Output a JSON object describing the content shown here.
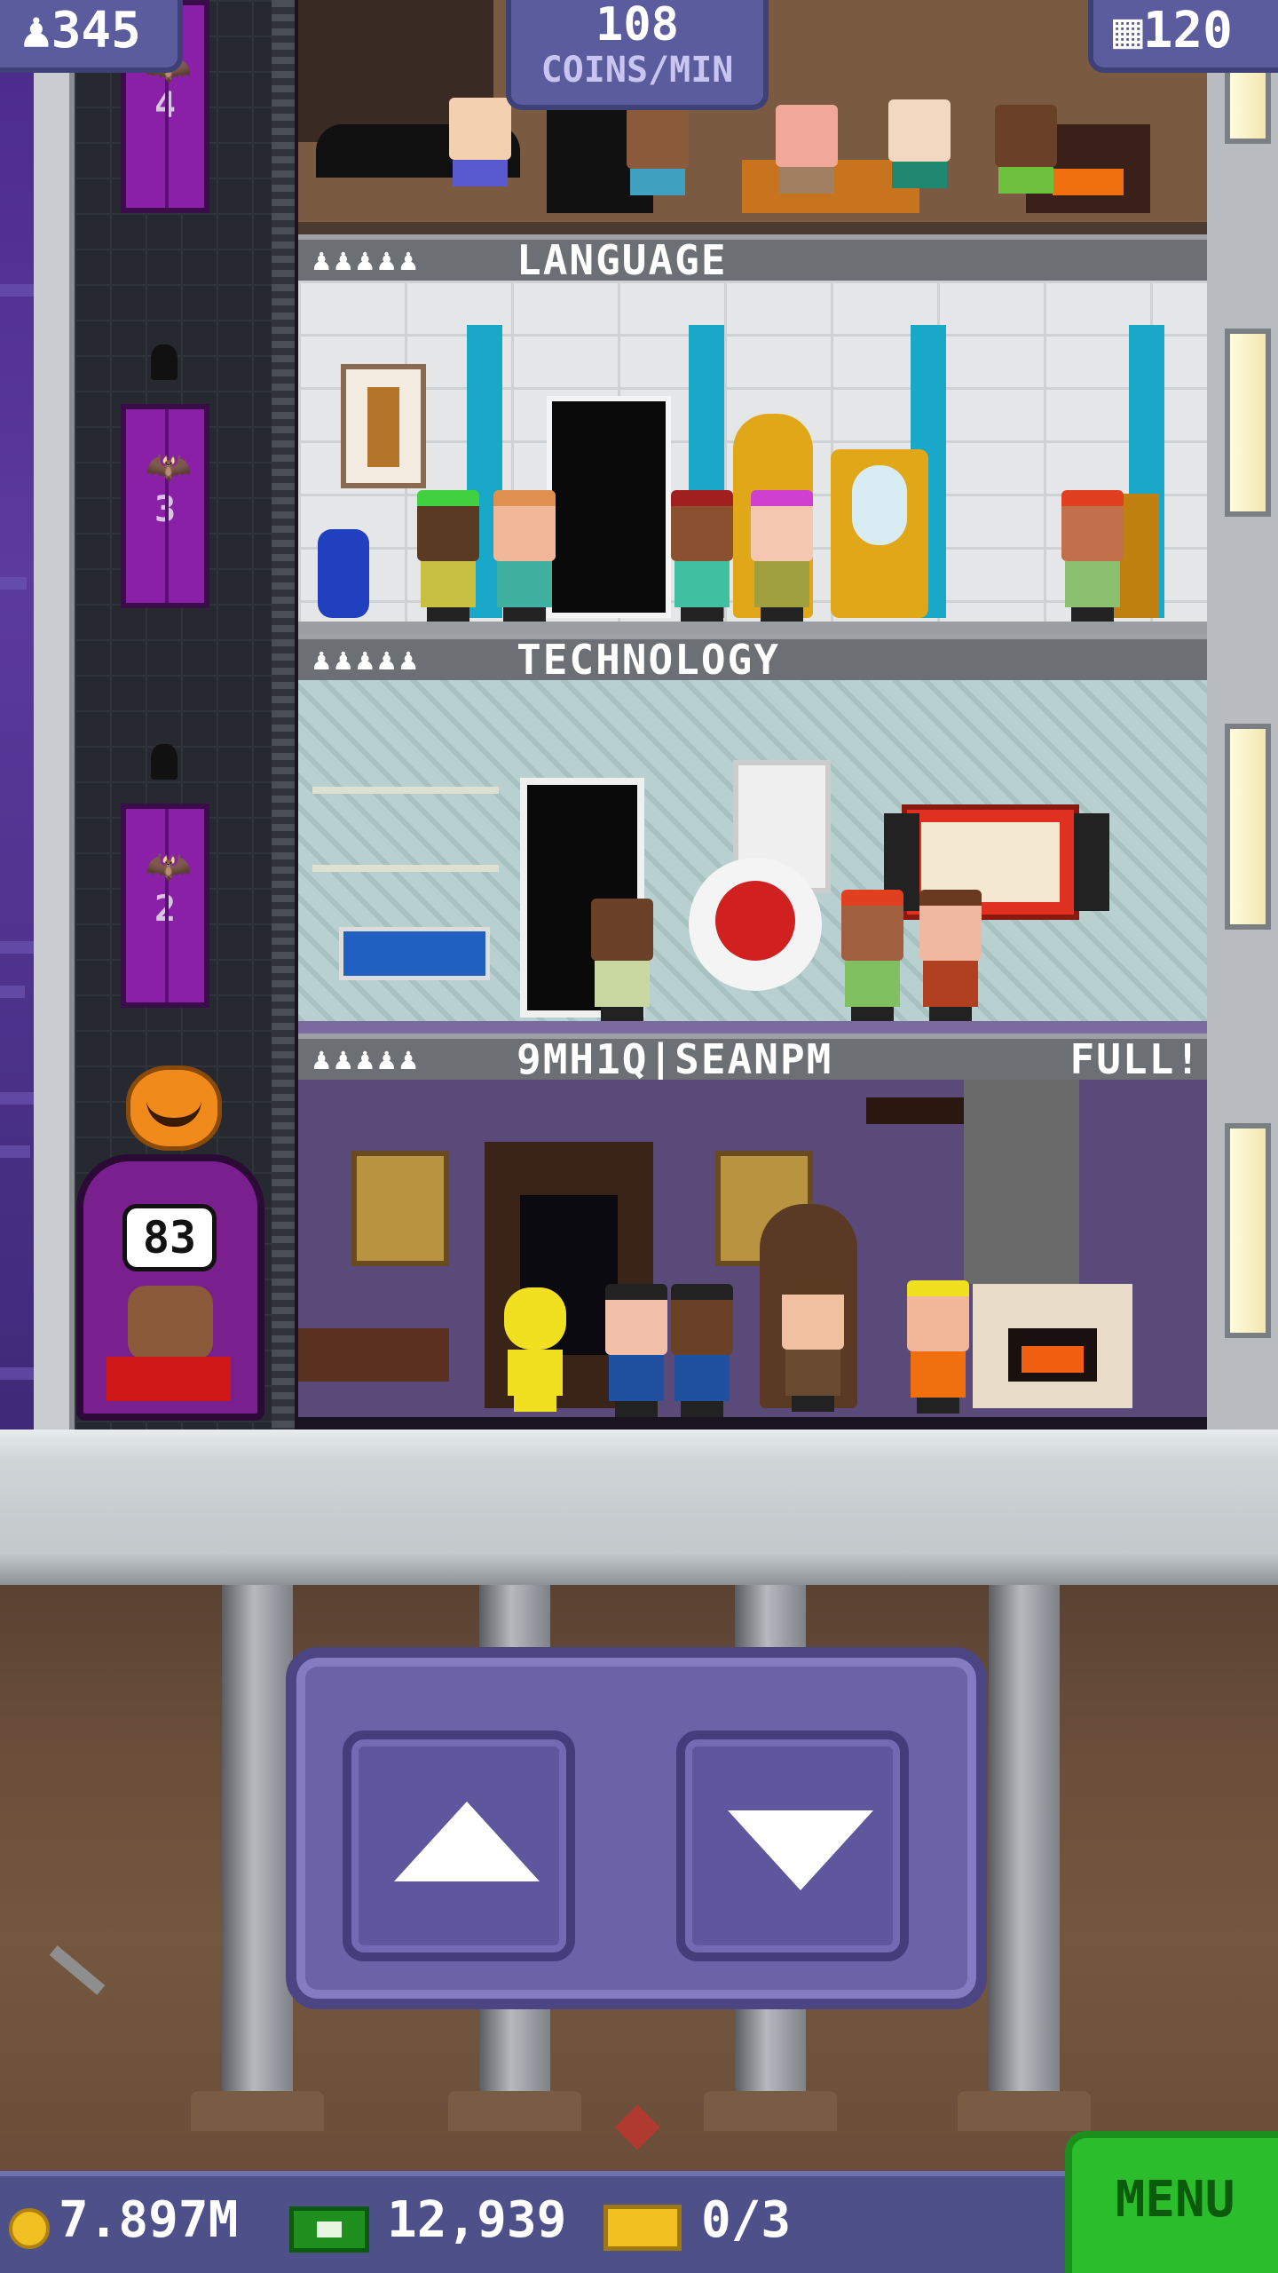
{
  "hud": {
    "population": "345",
    "coins_per_min_value": "108",
    "coins_per_min_label": "COINS/MIN",
    "floor_count": "120"
  },
  "elevator": {
    "floor_numbers": [
      "4",
      "3",
      "2"
    ],
    "sign_value": "83"
  },
  "floors": [
    {
      "name": "LANGUAGE",
      "people_icons": "♟♟♟♟♟",
      "status": ""
    },
    {
      "name": "TECHNOLOGY",
      "people_icons": "♟♟♟♟♟",
      "status": ""
    },
    {
      "name": "9MH1Q|SEANPM",
      "people_icons": "♟♟♟♟♟",
      "status": "FULL!"
    }
  ],
  "bottom_bar": {
    "coins": "7.897M",
    "bux": "12,939",
    "tickets": "0/3",
    "menu_label": "MENU"
  },
  "colors": {
    "hud_bg": "#5a5c9e",
    "elevator_door": "#8a1fa8",
    "menu_button": "#2bbd2b",
    "panel": "#6a63a8"
  }
}
